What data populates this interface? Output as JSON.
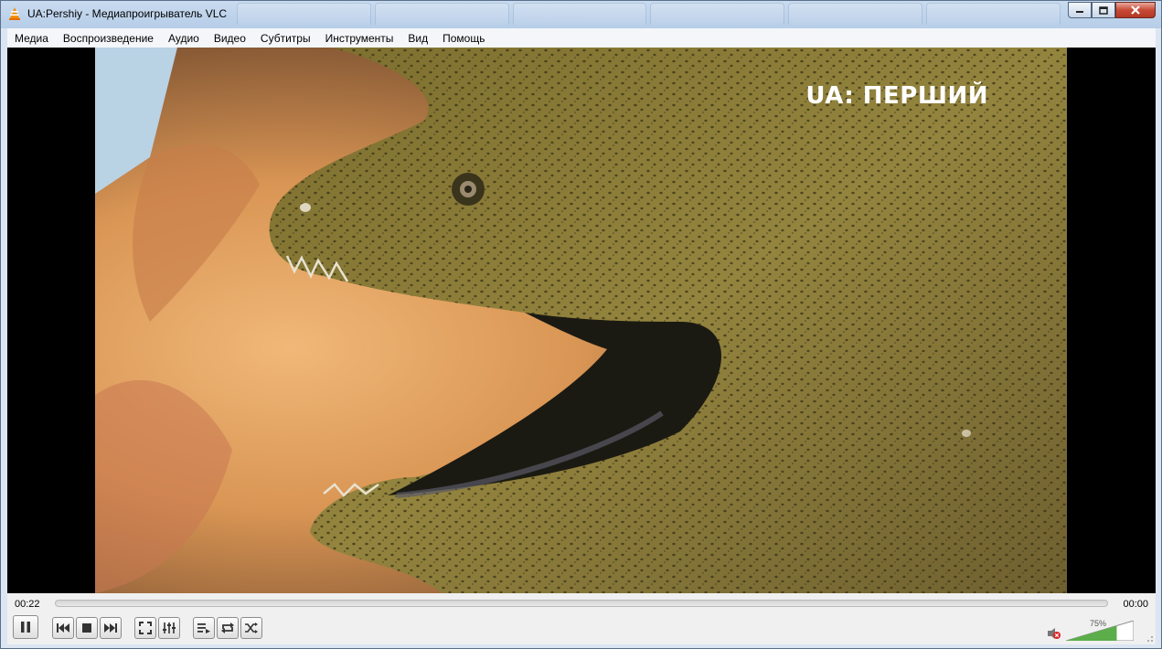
{
  "window": {
    "title": "UA:Pershiy - Медиапроигрыватель VLC",
    "controls": [
      "minimize",
      "maximize",
      "close"
    ]
  },
  "menu": {
    "items": [
      "Медиа",
      "Воспроизведение",
      "Аудио",
      "Видео",
      "Субтитры",
      "Инструменты",
      "Вид",
      "Помощь"
    ]
  },
  "video": {
    "channel_logo": "UA: ПЕРШИЙ",
    "content": "moray-eel-underwater"
  },
  "playback": {
    "elapsed": "00:22",
    "total": "00:00",
    "progress": 0
  },
  "buttons": {
    "pause": "pause-icon",
    "previous": "previous-icon",
    "stop": "stop-icon",
    "next": "next-icon",
    "fullscreen": "fullscreen-icon",
    "extended_settings": "equalizer-icon",
    "playlist": "playlist-icon",
    "loop": "loop-icon",
    "shuffle": "shuffle-icon"
  },
  "volume": {
    "percent_label": "75%",
    "level": 0.75,
    "muted": true
  },
  "colors": {
    "titlebar": "#c0d4ec",
    "menubar": "#f4f6f9",
    "video_bg": "#000000",
    "controls_bg": "#f0f0f0",
    "volume_fill": "#5cae4a"
  }
}
